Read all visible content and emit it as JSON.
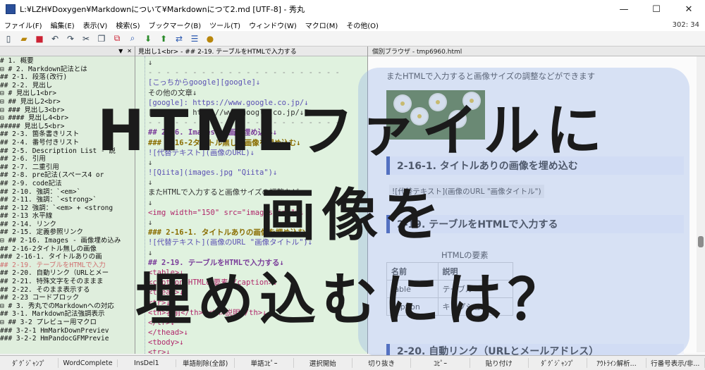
{
  "window": {
    "title": "L:¥LZH¥Doxygen¥Markdownについて¥Markdownにつて2.md  [UTF-8] - 秀丸",
    "minimize": "—",
    "maximize": "☐",
    "close": "✕"
  },
  "menu": {
    "items": [
      "ファイル(F)",
      "編集(E)",
      "表示(V)",
      "検索(S)",
      "ブックマーク(B)",
      "ツール(T)",
      "ウィンドウ(W)",
      "マクロ(M)",
      "その他(O)"
    ],
    "cursor_position": "302: 34"
  },
  "toolbar": {
    "icons": [
      "new-file-icon",
      "open-folder-icon",
      "save-icon",
      "undo-icon",
      "redo-icon",
      "cut-icon",
      "copy-icon",
      "paste-icon",
      "search-icon",
      "search-down-icon",
      "search-up-icon",
      "replace-icon",
      "split-window-icon",
      "macro-icon"
    ]
  },
  "outline": {
    "items": [
      "# 1. 概要",
      "⊟ # 2. Markdown記法とは",
      "   ## 2-1. 段落(改行)",
      "   ## 2-2. 見出し",
      "⊟ # 見出し1<br>",
      "  ⊟ ## 見出し2<br>",
      "    ⊟ ### 見出し3<br>",
      "      ⊟ #### 見出し4<br>",
      "          ##### 見出し5<br>",
      "   ## 2-3. 箇条書きリスト",
      "   ## 2-4. 番号付きリスト",
      "   ## 2-5. Description List - 説",
      "   ## 2-6. 引用",
      "   ## 2-7. 二重引用",
      "   ## 2-8. pre記法(スペース4 or",
      "   ## 2-9. code記法",
      "   ## 2-10. 強調：`<em>`",
      "   ## 2-11. 強調：`<strong>`",
      "   ## 2-12 強調：`<em> + <strong",
      "   ## 2-13 水平線",
      "   ## 2-14. リンク",
      "   ## 2-15. 定義参照リンク",
      "  ⊟ ## 2-16. Images - 画像埋め込み",
      "      ## 2-16-2タイトル無しの画像",
      "      ### 2-16-1. タイトルありの画",
      "   ## 2-19. テーブルをHTMLで入力",
      "   ## 2-20. 自動リンク（URLとメー",
      "   ## 2-21. 特殊文字をそのままま",
      "   ## 2-22. そのまま表示する",
      "   ## 2-23 コードブロック",
      "⊟ # 3. 秀丸でのMarkdownへの対応",
      "   ## 3-1. Markdown記法強調表示",
      "  ⊟ ## 3-2 プレビュー用マクロ",
      "      ### 3-2-1 HmMarkDownPreviev",
      "      ### 3-2-2 HmPandocGFMPrevie"
    ],
    "selected_index": 25
  },
  "editor": {
    "tab_label": "見出し1<br> - ## 2-19. テーブルをHTMLで入力する",
    "lines": [
      {
        "t": "↓",
        "c": "c-plain"
      },
      {
        "t": "- - - - - - - - - - - - - - - - - - - - - - ",
        "c": "c-sep"
      },
      {
        "t": "[こっちからgoogle][google]↓",
        "c": "c-link"
      },
      {
        "t": "その他の文章↓",
        "c": "c-plain"
      },
      {
        "t": "[google]: https://www.google.co.jp/↓",
        "c": "c-link"
      },
      {
        "t": "[google]: http://www.google.co.jp/↓",
        "c": "c-plain"
      },
      {
        "t": "- - - - - - - - - - - - - - - - - - - - - - ",
        "c": "c-sep"
      },
      {
        "t": "## 2-16. Images - 画像埋め込み↓",
        "c": "c-head"
      },
      {
        "t": "### 2-16-2タイトル無しの画像を埋め込む↓",
        "c": "c-head2"
      },
      {
        "t": "![代替テキスト](画像のURL)↓",
        "c": "c-link"
      },
      {
        "t": "↓",
        "c": "c-plain"
      },
      {
        "t": "![Qiita](images.jpg \"Qiita\")↓",
        "c": "c-link"
      },
      {
        "t": "↓",
        "c": "c-plain"
      },
      {
        "t": "またHTMLで入力すると画像サイズの調整など↓",
        "c": "c-plain"
      },
      {
        "t": "↓",
        "c": "c-plain"
      },
      {
        "t": "<img width=\"150\" src=\"images.jpg\">↓",
        "c": "c-tag"
      },
      {
        "t": "↓",
        "c": "c-plain"
      },
      {
        "t": "### 2-16-1. タイトルありの画像を埋め込む↓",
        "c": "c-head2"
      },
      {
        "t": "![代替テキスト](画像のURL \"画像タイトル\")↓",
        "c": "c-link"
      },
      {
        "t": "↓",
        "c": "c-plain"
      },
      {
        "t": "## 2-19. テーブルをHTMLで入力する↓",
        "c": "c-head"
      },
      {
        "t": "<table>↓",
        "c": "c-tag"
      },
      {
        "t": "  <caption>HTMLの要素</caption>↓",
        "c": "c-tag"
      },
      {
        "t": "  <thead>↓",
        "c": "c-tag"
      },
      {
        "t": "    <tr>↓",
        "c": "c-tag"
      },
      {
        "t": "      <th>名前</th> <th>説明</th>↓",
        "c": "c-tag"
      },
      {
        "t": "    </tr>↓",
        "c": "c-tag"
      },
      {
        "t": "  </thead>↓",
        "c": "c-tag"
      },
      {
        "t": "  <tbody>↓",
        "c": "c-tag"
      },
      {
        "t": "    <tr>↓",
        "c": "c-tag"
      }
    ]
  },
  "preview": {
    "tab_label": "個別ブラウザ - tmp6960.html",
    "intro_text": "またHTMLで入力すると画像サイズの調整などができます",
    "heading_16_1": "2-16-1. タイトルありの画像を埋め込む",
    "markdown_line": "![代替テキスト](画像のURL \"画像タイトル\")",
    "heading_19": "2-19. テーブルをHTMLで入力する",
    "table_caption": "HTMLの要素",
    "table_headers": [
      "名前",
      "説明"
    ],
    "table_rows": [
      [
        "table",
        "テーブル"
      ],
      [
        "caption",
        "キャプション"
      ]
    ],
    "heading_20": "2-20. 自動リンク（URLとメールアドレス）"
  },
  "overlay": {
    "line1": "HTMLファイルに",
    "line2": "画像を",
    "line3": "埋め込むには？"
  },
  "statusbar": {
    "items": [
      "ﾀﾞｸﾞｼﾞｬﾝﾌﾟ",
      "WordComplete",
      "InsDel1",
      "単語削除(全部)",
      "単語ｺﾋﾟｰ",
      "選択開始",
      "切り抜き",
      "ｺﾋﾟｰ",
      "貼り付け",
      "ﾀﾞｸﾞｼﾞｬﾝﾌﾟ",
      "ｱｳﾄﾗｲﾝ解析...",
      "行番号表示/非..."
    ]
  }
}
